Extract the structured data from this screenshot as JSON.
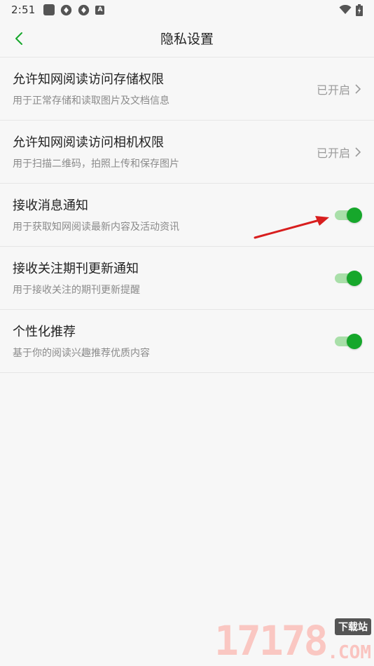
{
  "status_bar": {
    "time": "2:51",
    "left_icons": [
      "square-icon",
      "sync-icon",
      "sync-icon",
      "a-icon"
    ],
    "a_icon_label": "A",
    "right_icons": [
      "wifi-icon",
      "battery-icon"
    ]
  },
  "header": {
    "title": "隐私设置"
  },
  "settings": [
    {
      "title": "允许知网阅读访问存储权限",
      "desc": "用于正常存储和读取图片及文档信息",
      "status": "已开启",
      "control": "link"
    },
    {
      "title": "允许知网阅读访问相机权限",
      "desc": "用于扫描二维码，拍照上传和保存图片",
      "status": "已开启",
      "control": "link"
    },
    {
      "title": "接收消息通知",
      "desc": "用于获取知网阅读最新内容及活动资讯",
      "on": true,
      "control": "toggle"
    },
    {
      "title": "接收关注期刊更新通知",
      "desc": "用于接收关注的期刊更新提醒",
      "on": true,
      "control": "toggle"
    },
    {
      "title": "个性化推荐",
      "desc": "基于你的阅读兴趣推荐优质内容",
      "on": true,
      "control": "toggle"
    }
  ],
  "watermark": {
    "number": "17178",
    "tag": "下载站",
    "suffix": ".COM"
  },
  "colors": {
    "accent_green": "#16a72b",
    "track_green": "#a9dfa9",
    "arrow_red": "#d81e1e"
  }
}
